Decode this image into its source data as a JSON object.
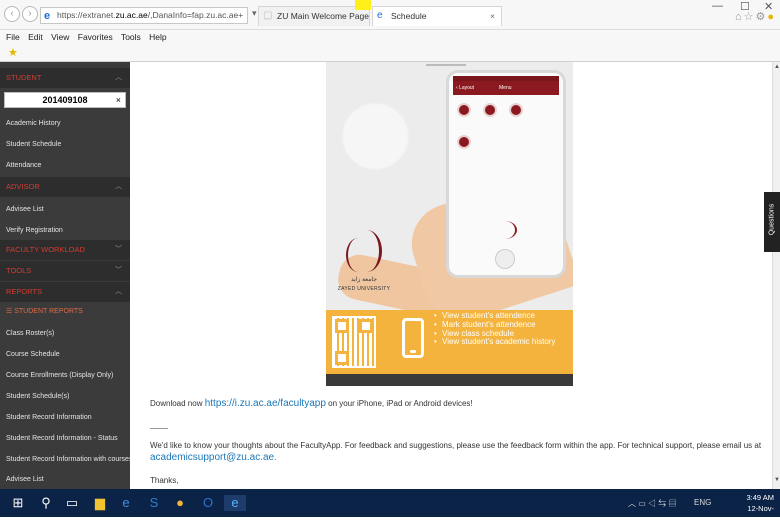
{
  "browser": {
    "address": "https://extranet.zu.ac.ae/,DanaInfo=fap.zu.ac.ae+",
    "address_prefix": "https://extranet.",
    "address_host": "zu.ac.ae",
    "address_suffix": "/,DanaInfo=fap.zu.ac.ae+",
    "tabs": [
      {
        "label": "ZU Main Welcome Page Layout ...",
        "active": false
      },
      {
        "label": "Schedule",
        "active": true
      }
    ],
    "menu": [
      "File",
      "Edit",
      "View",
      "Favorites",
      "Tools",
      "Help"
    ],
    "window_controls": {
      "minimize": "—",
      "restore": "☐",
      "close": "✕"
    }
  },
  "sidebar": {
    "sections": [
      {
        "title": "STUDENT",
        "state": "expanded"
      },
      {
        "title": "ADVISOR",
        "state": "expanded"
      },
      {
        "title": "FACULTY WORKLOAD",
        "state": "collapsed"
      },
      {
        "title": "TOOLS",
        "state": "collapsed"
      },
      {
        "title": "REPORTS",
        "state": "expanded"
      }
    ],
    "student_id": "201409108",
    "clear_glyph": "×",
    "student_items": [
      "Academic History",
      "Student Schedule",
      "Attendance"
    ],
    "advisor_items": [
      "Advisee List",
      "Verify Registration"
    ],
    "reports_sub_header": "STUDENT REPORTS",
    "reports_items": [
      "Class Roster(s)",
      "Course Schedule",
      "Course Enrollments (Display Only)",
      "Student Schedule(s)",
      "Student Record Information",
      "Student Record Information - Status",
      "Student Record Information with courses",
      "Advisee List"
    ]
  },
  "promo": {
    "phone_back": "Layout",
    "phone_title": "Menu",
    "zu_arabic": "جامعة زايد",
    "zu_name": "ZAYED UNIVERSITY",
    "features": [
      "View student's attendence",
      "Mark student's attendence",
      "View class schedule",
      "View student's academic history"
    ]
  },
  "content": {
    "download_prefix": "Download now ",
    "download_link": "https://i.zu.ac.ae/facultyapp",
    "download_suffix": " on your iPhone, iPad or Android devices!",
    "feedback_text": "We'd like to know your thoughts about the FacultyApp. For feedback and suggestions, please use the feedback form within the app. For technical support, please email us at",
    "support_email": "academicsupport@zu.ac.ae",
    "support_email_suffix": ".",
    "closing": "Thanks,"
  },
  "questions_tab": "Questions",
  "taskbar": {
    "lang": "ENG",
    "time": "3:49 AM",
    "date": "12-Nov-19"
  }
}
